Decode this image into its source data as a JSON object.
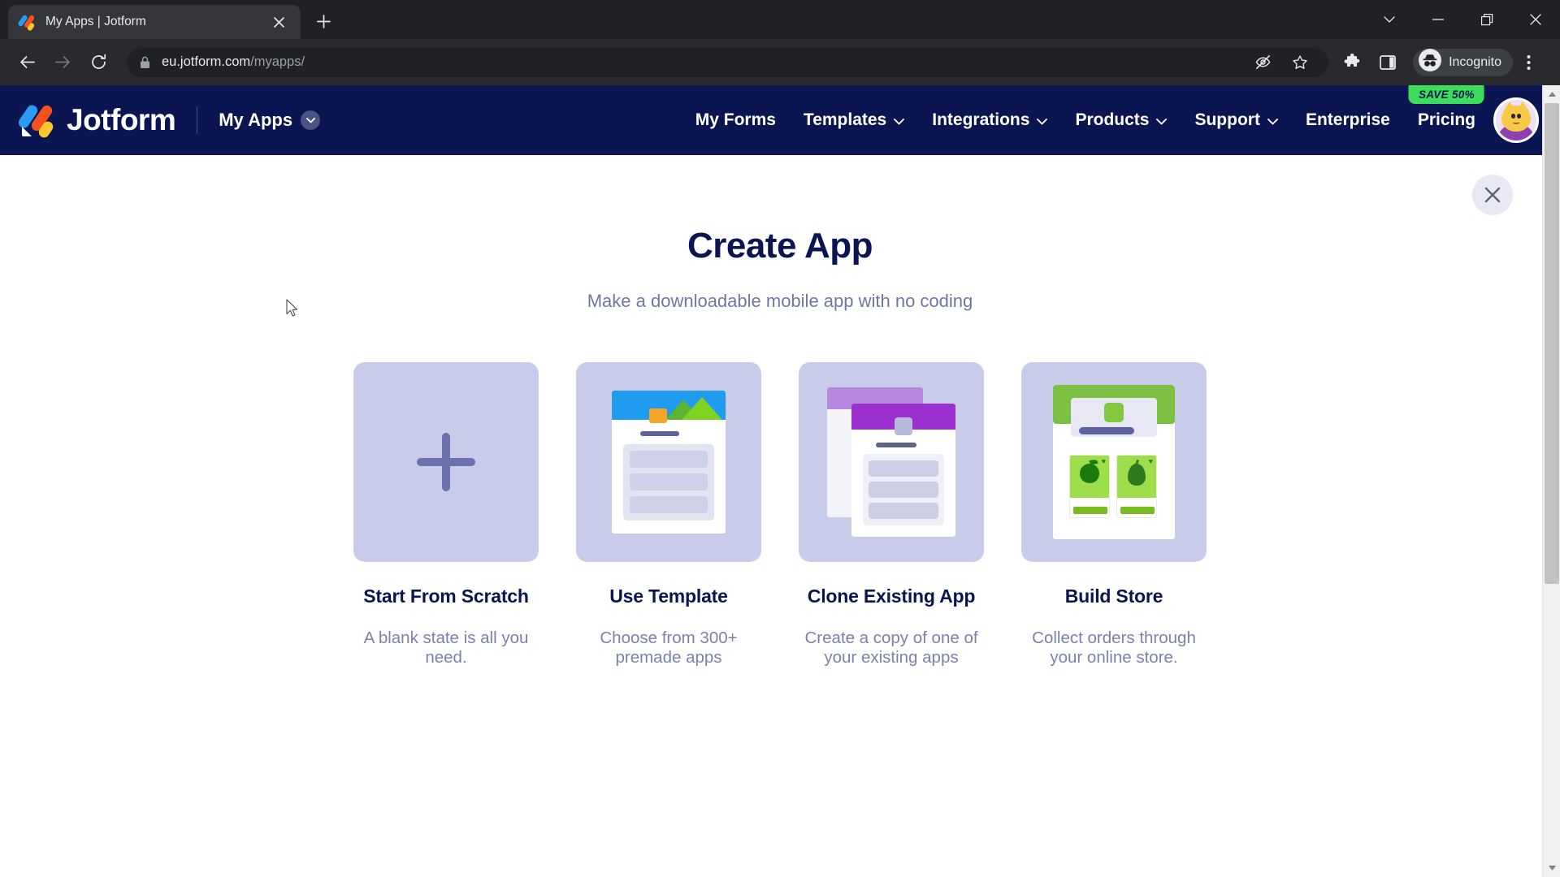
{
  "browser": {
    "tab": {
      "title": "My Apps | Jotform",
      "favicon": "jotform-favicon",
      "close": "×"
    },
    "new_tab_label": "+",
    "window_controls": {
      "minimize_group": "⌄",
      "minimize": "—",
      "maximize": "❐",
      "close": "✕"
    },
    "toolbar": {
      "back": "back-arrow",
      "forward": "forward-arrow",
      "reload": "reload-arrow",
      "lock": "lock-icon",
      "url_domain": "eu.jotform.com",
      "url_path": "/myapps/",
      "tracking_protection": "eye-slash-icon",
      "bookmark": "star-icon",
      "extensions": "puzzle-icon",
      "side_panel": "side-panel-icon",
      "incognito_label": "Incognito",
      "menu": "three-dot-menu-icon"
    }
  },
  "header": {
    "brand": "Jotform",
    "workspace_label": "My Apps",
    "nav": [
      {
        "label": "My Forms",
        "has_caret": false
      },
      {
        "label": "Templates",
        "has_caret": true
      },
      {
        "label": "Integrations",
        "has_caret": true
      },
      {
        "label": "Products",
        "has_caret": true
      },
      {
        "label": "Support",
        "has_caret": true
      },
      {
        "label": "Enterprise",
        "has_caret": false
      },
      {
        "label": "Pricing",
        "has_caret": false,
        "badge": "SAVE 50%"
      }
    ],
    "badge_color": "#3cdd5b",
    "bg_color": "#0a1551",
    "avatar": "user-avatar-cat"
  },
  "modal": {
    "close_label": "✕",
    "title": "Create App",
    "subtitle": "Make a downloadable mobile app with no coding",
    "cards": [
      {
        "id": "start-from-scratch",
        "title": "Start From Scratch",
        "description": "A blank state is all you need.",
        "thumb": "plus-icon"
      },
      {
        "id": "use-template",
        "title": "Use Template",
        "description": "Choose from 300+ premade apps",
        "thumb": "template-preview"
      },
      {
        "id": "clone-existing-app",
        "title": "Clone Existing App",
        "description": "Create a copy of one of your existing apps",
        "thumb": "clone-preview"
      },
      {
        "id": "build-store",
        "title": "Build Store",
        "description": "Collect orders through your online store.",
        "thumb": "store-preview"
      }
    ]
  },
  "colors": {
    "brand_navy": "#0a1551",
    "card_bg": "#c9cbeb",
    "muted_text": "#7b81ad"
  }
}
